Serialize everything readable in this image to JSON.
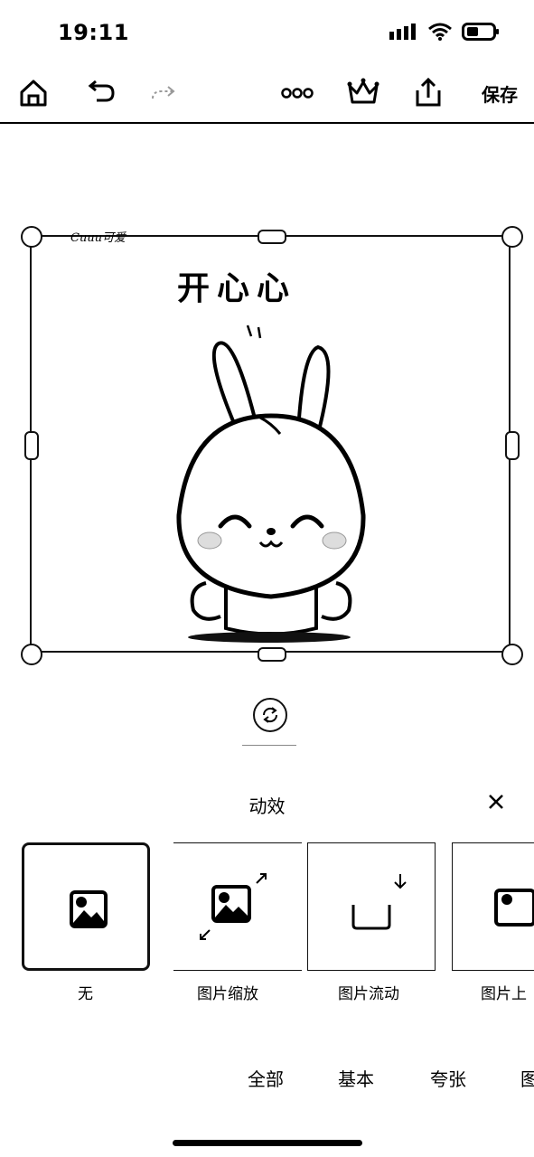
{
  "status_bar": {
    "time": "19:11"
  },
  "toolbar": {
    "save_label": "保存"
  },
  "canvas": {
    "watermark": "Cuuu可爱",
    "title_text": "开心心"
  },
  "panel": {
    "title": "动效",
    "effects": [
      {
        "label": "无"
      },
      {
        "label": "图片缩放"
      },
      {
        "label": "图片流动"
      },
      {
        "label": "图片上"
      }
    ],
    "categories": [
      {
        "label": "全部"
      },
      {
        "label": "基本"
      },
      {
        "label": "夸张"
      },
      {
        "label": "图"
      }
    ]
  },
  "icons": {
    "home": "home-icon",
    "undo": "undo-icon",
    "redo": "redo-icon",
    "more": "more-icon",
    "crown": "crown-icon",
    "share": "share-icon",
    "rotate": "rotate-icon",
    "close": "close-icon",
    "image": "image-icon"
  }
}
